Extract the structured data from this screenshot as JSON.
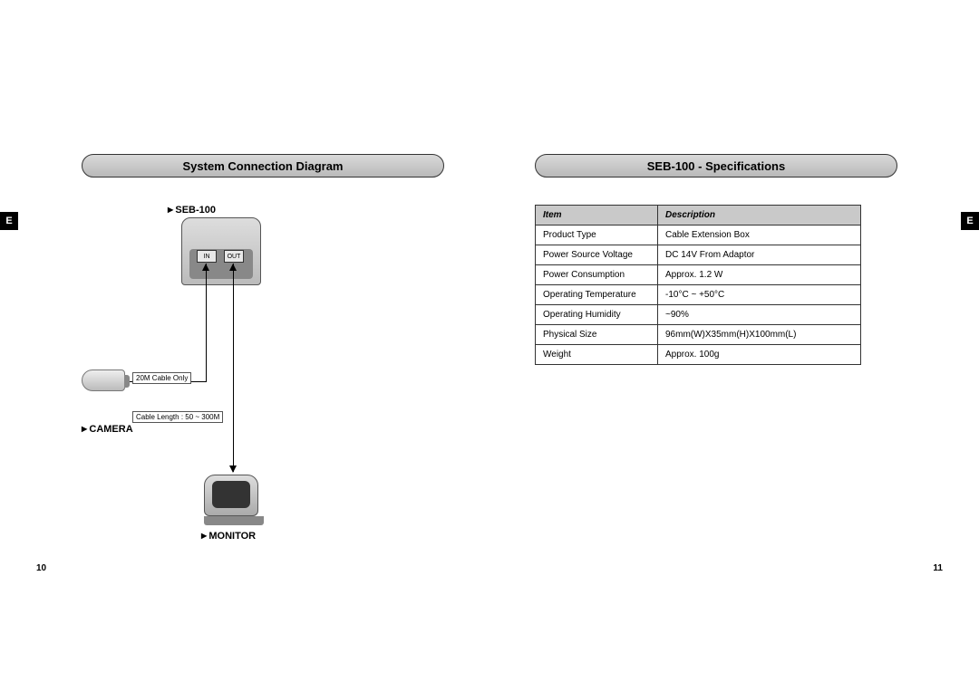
{
  "left": {
    "tab": "E",
    "title": "System Connection Diagram",
    "labels": {
      "seb": "SEB-100",
      "camera": "CAMERA",
      "monitor": "MONITOR",
      "in": "IN",
      "out": "OUT",
      "cable_only": "20M Cable Only",
      "cable_length": "Cable Length : 50 ~ 300M"
    },
    "pageNum": "10"
  },
  "right": {
    "tab": "E",
    "title": "SEB-100 - Specifications",
    "table": {
      "header": {
        "item": "Item",
        "desc": "Description"
      },
      "rows": [
        {
          "item": "Product Type",
          "desc": "Cable Extension Box"
        },
        {
          "item": "Power Source Voltage",
          "desc": "DC 14V From Adaptor"
        },
        {
          "item": "Power Consumption",
          "desc": "Approx. 1.2 W"
        },
        {
          "item": "Operating Temperature",
          "desc": "-10°C ~ +50°C"
        },
        {
          "item": "Operating Humidity",
          "desc": "~90%"
        },
        {
          "item": "Physical Size",
          "desc": "96mm(W)X35mm(H)X100mm(L)"
        },
        {
          "item": "Weight",
          "desc": "Approx. 100g"
        }
      ]
    },
    "pageNum": "11"
  }
}
